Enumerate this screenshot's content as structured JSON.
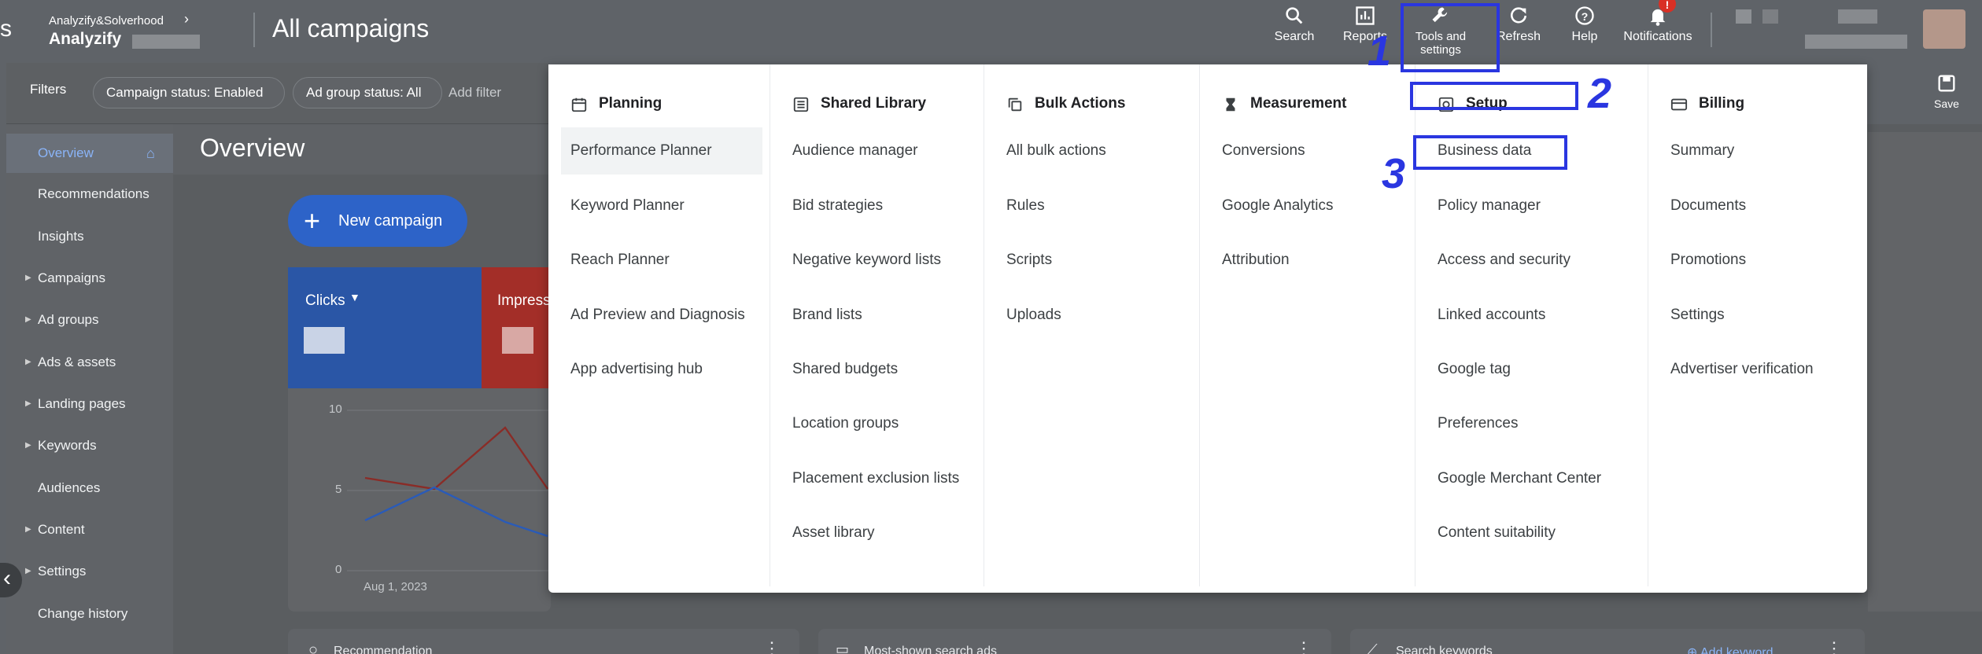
{
  "header": {
    "account_path": "Analyzify&Solverhood",
    "account_name": "Analyzify",
    "page_title": "All campaigns",
    "buttons": [
      {
        "label": "Search",
        "icon": "search-icon"
      },
      {
        "label": "Reports",
        "icon": "reports-icon"
      },
      {
        "label": "Tools and settings",
        "icon": "wrench-icon"
      },
      {
        "label": "Refresh",
        "icon": "refresh-icon"
      },
      {
        "label": "Help",
        "icon": "help-icon"
      },
      {
        "label": "Notifications",
        "icon": "bell-icon"
      }
    ]
  },
  "filters": {
    "label": "Filters",
    "chips": [
      "Campaign status: Enabled",
      "Ad group status: All"
    ],
    "add_filter": "Add filter",
    "save_label": "Save"
  },
  "sidebar": {
    "items": [
      {
        "label": "Overview",
        "active": true
      },
      {
        "label": "Recommendations"
      },
      {
        "label": "Insights"
      },
      {
        "label": "Campaigns",
        "expandable": true
      },
      {
        "label": "Ad groups",
        "expandable": true
      },
      {
        "label": "Ads & assets",
        "expandable": true
      },
      {
        "label": "Landing pages",
        "expandable": true
      },
      {
        "label": "Keywords",
        "expandable": true
      },
      {
        "label": "Audiences"
      },
      {
        "label": "Content",
        "expandable": true
      },
      {
        "label": "Settings",
        "expandable": true
      },
      {
        "label": "Change history"
      }
    ]
  },
  "main": {
    "overview_title": "Overview",
    "new_campaign": "New campaign",
    "metric_clicks": "Clicks",
    "metric_impressions": "Impress",
    "chart_ticks": [
      "10",
      "5",
      "0"
    ],
    "chart_date": "Aug 1, 2023",
    "bottom_cards": [
      "Recommendation",
      "Most-shown search ads",
      "Search keywords"
    ],
    "add_keyword": "Add keyword"
  },
  "menu": {
    "columns": [
      {
        "title": "Planning",
        "icon": "calendar-icon",
        "items": [
          "Performance Planner",
          "Keyword Planner",
          "Reach Planner",
          "Ad Preview and Diagnosis",
          "App advertising hub"
        ]
      },
      {
        "title": "Shared Library",
        "icon": "library-icon",
        "items": [
          "Audience manager",
          "Bid strategies",
          "Negative keyword lists",
          "Brand lists",
          "Shared budgets",
          "Location groups",
          "Placement exclusion lists",
          "Asset library"
        ]
      },
      {
        "title": "Bulk Actions",
        "icon": "copy-icon",
        "items": [
          "All bulk actions",
          "Rules",
          "Scripts",
          "Uploads"
        ]
      },
      {
        "title": "Measurement",
        "icon": "hourglass-icon",
        "items": [
          "Conversions",
          "Google Analytics",
          "Attribution"
        ]
      },
      {
        "title": "Setup",
        "icon": "setup-icon",
        "items": [
          "Business data",
          "Policy manager",
          "Access and security",
          "Linked accounts",
          "Google tag",
          "Preferences",
          "Google Merchant Center",
          "Content suitability"
        ]
      },
      {
        "title": "Billing",
        "icon": "card-icon",
        "items": [
          "Summary",
          "Documents",
          "Promotions",
          "Settings",
          "Advertiser verification"
        ]
      }
    ]
  },
  "annotations": [
    "1",
    "2",
    "3"
  ],
  "colors": {
    "annotation": "#2a36e0",
    "primary_blue": "#1a73e8",
    "impressions_red": "#d93025"
  }
}
